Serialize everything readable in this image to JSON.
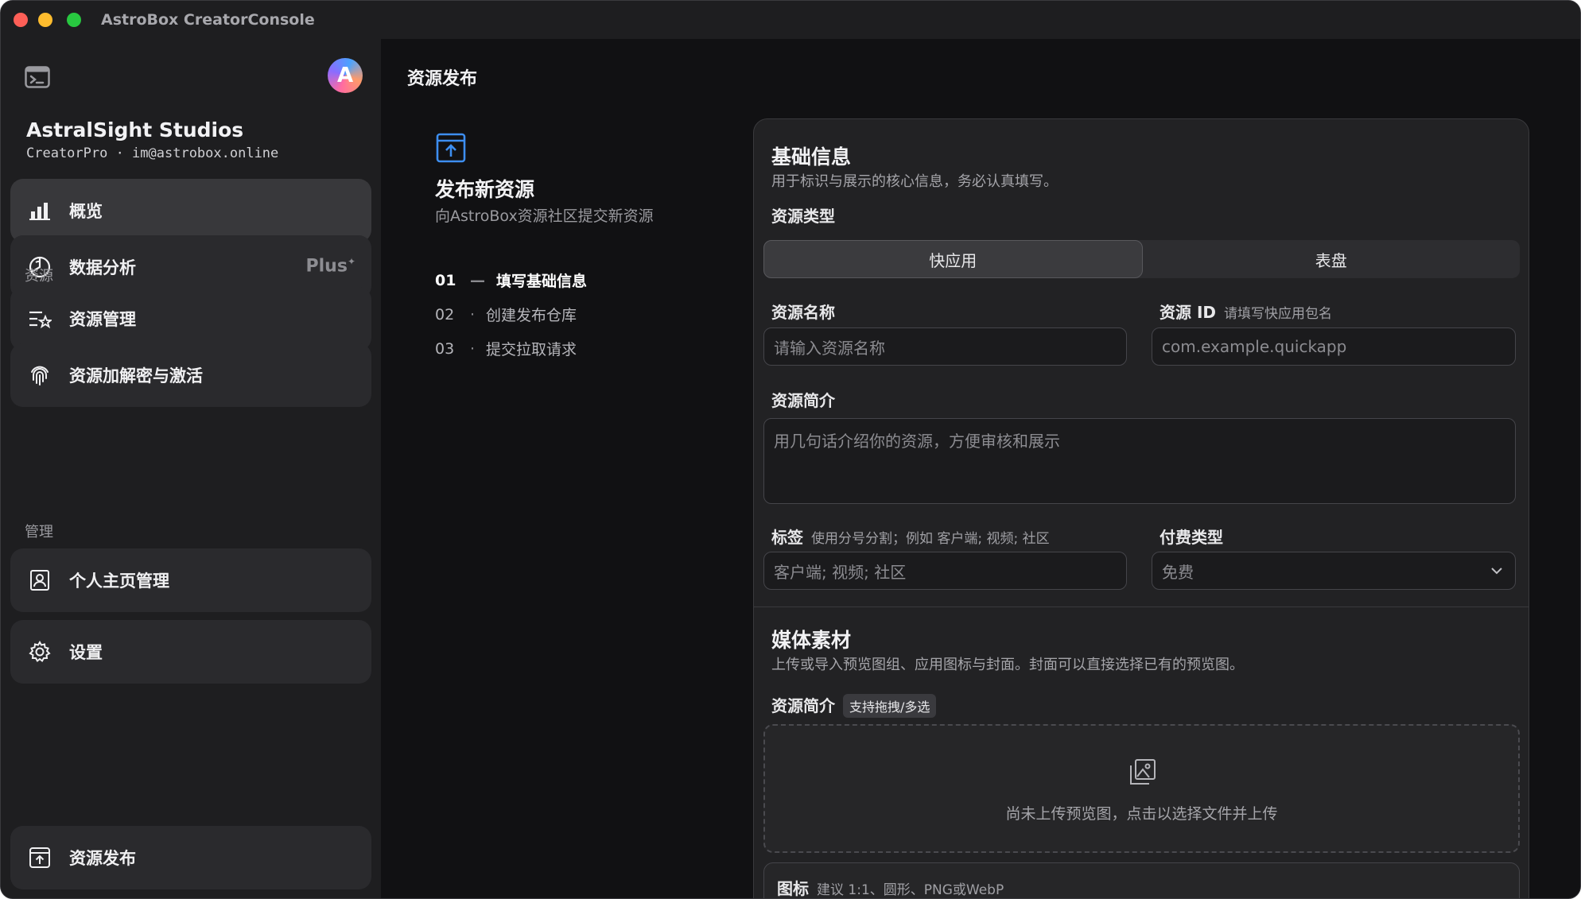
{
  "window": {
    "title": "AstroBox CreatorConsole"
  },
  "sidebar": {
    "avatar_letter": "A",
    "org_name": "AstralSight Studios",
    "org_sub": "CreatorPro · im@astrobox.online",
    "items": [
      {
        "label": "概览",
        "icon": "bar-chart-icon",
        "active": true
      },
      {
        "label": "数据分析",
        "icon": "pie-chart-icon",
        "badge": "Plus"
      },
      {
        "label": "资源管理",
        "icon": "list-star-icon"
      },
      {
        "label": "资源加解密与激活",
        "icon": "fingerprint-icon"
      },
      {
        "label": "个人主页管理",
        "icon": "profile-icon"
      },
      {
        "label": "设置",
        "icon": "gear-icon"
      },
      {
        "label": "资源发布",
        "icon": "upload-icon"
      }
    ],
    "sections": {
      "resources": "资源",
      "manage": "管理"
    }
  },
  "main": {
    "page_title": "资源发布",
    "steps": {
      "title": "发布新资源",
      "subtitle": "向AstroBox资源社区提交新资源",
      "items": [
        {
          "num": "01",
          "sep": "—",
          "label": "填写基础信息",
          "current": true
        },
        {
          "num": "02",
          "sep": "·",
          "label": "创建发布仓库"
        },
        {
          "num": "03",
          "sep": "·",
          "label": "提交拉取请求"
        }
      ]
    },
    "basic": {
      "title": "基础信息",
      "desc": "用于标识与展示的核心信息，务必认真填写。",
      "type_label": "资源类型",
      "type_options": [
        "快应用",
        "表盘"
      ],
      "type_selected": "快应用",
      "name_label": "资源名称",
      "name_placeholder": "请输入资源名称",
      "id_label": "资源 ID",
      "id_hint": "请填写快应用包名",
      "id_placeholder": "com.example.quickapp",
      "intro_label": "资源简介",
      "intro_placeholder": "用几句话介绍你的资源，方便审核和展示",
      "tags_label": "标签",
      "tags_hint": "使用分号分割；例如 客户端; 视频; 社区",
      "tags_placeholder": "客户端; 视频; 社区",
      "pay_label": "付费类型",
      "pay_value": "免费"
    },
    "media": {
      "title": "媒体素材",
      "desc": "上传或导入预览图组、应用图标与封面。封面可以直接选择已有的预览图。",
      "preview_label": "资源简介",
      "preview_badge": "支持拖拽/多选",
      "dropzone_text": "尚未上传预览图，点击以选择文件并上传",
      "icon_label": "图标",
      "icon_hint": "建议 1:1、圆形、PNG或WebP"
    }
  },
  "colors": {
    "accent": "#3d8ef0",
    "background": "#111113",
    "sidebar": "#1e1e20"
  }
}
